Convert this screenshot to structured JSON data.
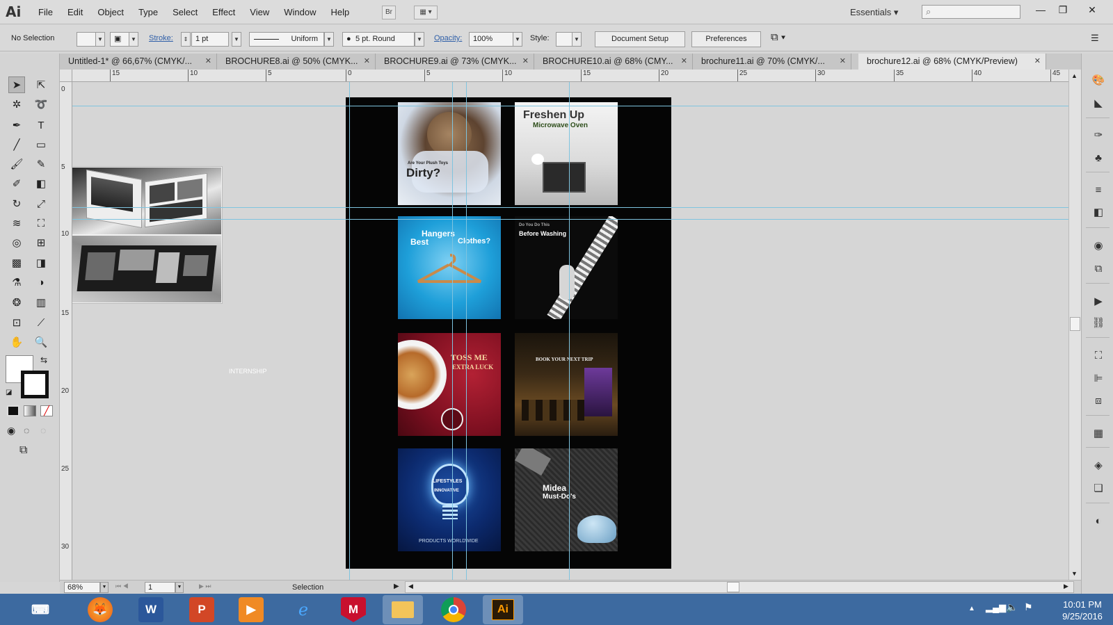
{
  "app": {
    "logo": "Ai"
  },
  "menu": [
    "File",
    "Edit",
    "Object",
    "Type",
    "Select",
    "Effect",
    "View",
    "Window",
    "Help"
  ],
  "bridge_button": "Br",
  "workspace": "Essentials",
  "control_bar": {
    "selection": "No Selection",
    "stroke_label": "Stroke:",
    "stroke_weight": "1 pt",
    "profile": "Uniform",
    "brush": "5 pt. Round",
    "opacity_label": "Opacity:",
    "opacity": "100%",
    "style_label": "Style:",
    "document_setup": "Document Setup",
    "preferences": "Preferences"
  },
  "tabs": [
    {
      "label": "Untitled-1* @ 66,67% (CMYK/..."
    },
    {
      "label": "BROCHURE8.ai @ 50% (CMYK..."
    },
    {
      "label": "BROCHURE9.ai @ 73% (CMYK..."
    },
    {
      "label": "BROCHURE10.ai @ 68% (CMY..."
    },
    {
      "label": "brochure11.ai @ 70% (CMYK/..."
    },
    {
      "label": "brochure12.ai @ 68% (CMYK/Preview)"
    }
  ],
  "ruler_top": [
    "15",
    "10",
    "5",
    "0",
    "5",
    "10",
    "15",
    "20",
    "25",
    "30",
    "35",
    "40",
    "45"
  ],
  "ruler_left": [
    "0",
    "5",
    "10",
    "15",
    "20",
    "25",
    "30"
  ],
  "posters": {
    "p1": {
      "title_small": "Are Your Plush Toys",
      "title": "Dirty?"
    },
    "p2": {
      "title": "Freshen Up",
      "subtitle": "Microwave Oven"
    },
    "p3": {
      "title_a": "Hangers",
      "title_b": "Best",
      "title_c": "Clothes?"
    },
    "p4": {
      "title_small": "Do You Do This",
      "title": "Before Washing"
    },
    "p5": {
      "title_a": "TOSS ME",
      "title_b": "EXTRA LUCK"
    },
    "p6": {
      "title": "BOOK YOUR NEXT TRIP"
    },
    "p7": {
      "title_a": "LIFESTYLES",
      "title_b": "INNOVATIVE",
      "footer": "PRODUCTS WORLDWIDE"
    },
    "p8": {
      "title_a": "Midea",
      "title_b": "Must-Do's"
    }
  },
  "canvas_label": "INTERNSHIP",
  "status_bar": {
    "zoom": "68%",
    "artboard": "1",
    "tool": "Selection"
  },
  "taskbar": {
    "time": "10:01 PM",
    "date": "9/25/2016"
  }
}
